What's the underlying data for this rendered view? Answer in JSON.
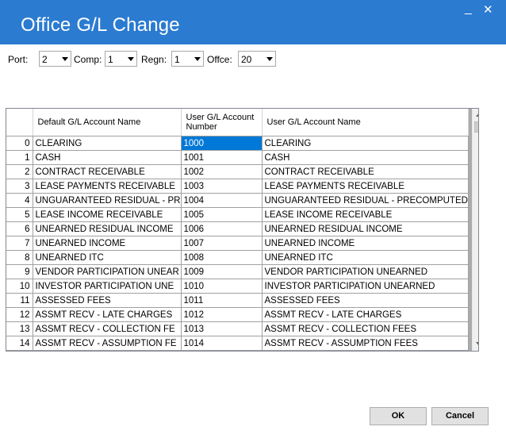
{
  "window": {
    "title": "Office G/L Change",
    "minimize_glyph": "_",
    "close_glyph": "✕"
  },
  "filters": [
    {
      "label": "Port:",
      "value": "2"
    },
    {
      "label": "Comp:",
      "value": "1"
    },
    {
      "label": "Regn:",
      "value": "1"
    },
    {
      "label": "Offce:",
      "value": "20"
    }
  ],
  "grid": {
    "headers": {
      "default_name": "Default G/L Account Name",
      "user_number": "User G/L Account Number",
      "user_name": "User G/L Account Name"
    },
    "rows": [
      {
        "idx": "0",
        "default_name": "CLEARING",
        "number": "1000",
        "user_name": "CLEARING"
      },
      {
        "idx": "1",
        "default_name": "CASH",
        "number": "1001",
        "user_name": "CASH"
      },
      {
        "idx": "2",
        "default_name": "CONTRACT RECEIVABLE",
        "number": "1002",
        "user_name": "CONTRACT RECEIVABLE"
      },
      {
        "idx": "3",
        "default_name": "LEASE PAYMENTS RECEIVABLE",
        "number": "1003",
        "user_name": "LEASE PAYMENTS RECEIVABLE"
      },
      {
        "idx": "4",
        "default_name": "UNGUARANTEED RESIDUAL - PR",
        "number": "1004",
        "user_name": "UNGUARANTEED RESIDUAL - PRECOMPUTED"
      },
      {
        "idx": "5",
        "default_name": "LEASE INCOME RECEIVABLE",
        "number": "1005",
        "user_name": "LEASE INCOME RECEIVABLE"
      },
      {
        "idx": "6",
        "default_name": "UNEARNED RESIDUAL INCOME",
        "number": "1006",
        "user_name": "UNEARNED RESIDUAL INCOME"
      },
      {
        "idx": "7",
        "default_name": "UNEARNED INCOME",
        "number": "1007",
        "user_name": "UNEARNED INCOME"
      },
      {
        "idx": "8",
        "default_name": "UNEARNED ITC",
        "number": "1008",
        "user_name": "UNEARNED ITC"
      },
      {
        "idx": "9",
        "default_name": "VENDOR PARTICIPATION UNEAR",
        "number": "1009",
        "user_name": "VENDOR PARTICIPATION UNEARNED"
      },
      {
        "idx": "10",
        "default_name": "INVESTOR PARTICIPATION UNE",
        "number": "1010",
        "user_name": "INVESTOR PARTICIPATION UNEARNED"
      },
      {
        "idx": "11",
        "default_name": "ASSESSED FEES",
        "number": "1011",
        "user_name": "ASSESSED FEES"
      },
      {
        "idx": "12",
        "default_name": "ASSMT RECV - LATE CHARGES",
        "number": "1012",
        "user_name": "ASSMT RECV - LATE CHARGES"
      },
      {
        "idx": "13",
        "default_name": "ASSMT RECV - COLLECTION FE",
        "number": "1013",
        "user_name": "ASSMT RECV - COLLECTION FEES"
      },
      {
        "idx": "14",
        "default_name": "ASSMT RECV - ASSUMPTION FE",
        "number": "1014",
        "user_name": "ASSMT RECV - ASSUMPTION FEES"
      }
    ]
  },
  "buttons": {
    "ok": "OK",
    "cancel": "Cancel"
  }
}
